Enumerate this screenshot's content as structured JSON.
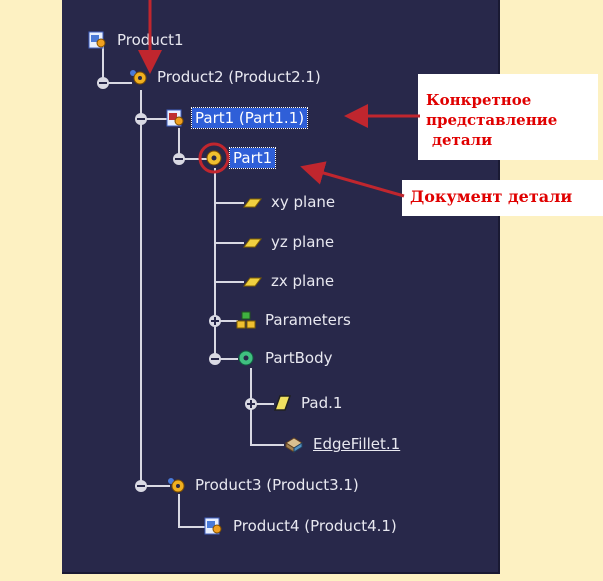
{
  "tree": {
    "product1": "Product1",
    "product2": "Product2 (Product2.1)",
    "part1_instance": "Part1 (Part1.1)",
    "part1_doc": "Part1",
    "xy_plane": "xy plane",
    "yz_plane": "yz plane",
    "zx_plane": "zx plane",
    "parameters": "Parameters",
    "partbody": "PartBody",
    "pad": "Pad.1",
    "edgefillet": "EdgeFillet.1",
    "product3": "Product3 (Product3.1)",
    "product4": "Product4 (Product4.1)"
  },
  "callouts": {
    "instance_line1": "Конкретное",
    "instance_line2": "представление",
    "instance_line3": "детали",
    "document": "Документ детали"
  },
  "colors": {
    "panel_bg": "#28284a",
    "page_bg": "#fdf1c2",
    "selection": "#2f5fd8",
    "annotation": "#c0262e"
  }
}
